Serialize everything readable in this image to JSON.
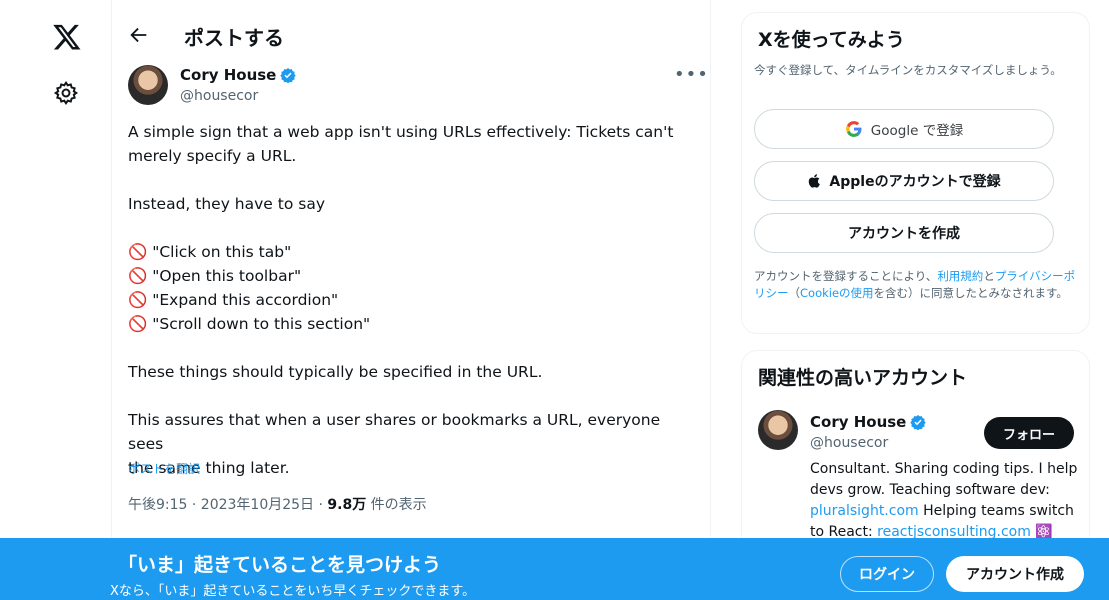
{
  "nav": {
    "logo_icon": "x-logo-icon",
    "settings_icon": "gear-icon"
  },
  "header": {
    "title": "ポストする",
    "back_icon": "arrow-left-icon"
  },
  "tweet": {
    "author_name": "Cory House",
    "author_handle": "@housecor",
    "more_icon": "more-horizontal-icon",
    "lines": [
      "A simple sign that a web app isn't using URLs effectively: Tickets can't",
      "merely specify a URL.",
      "",
      "Instead, they have to say",
      "",
      "🚫 \"Click on this tab\"",
      "🚫 \"Open this toolbar\"",
      "🚫 \"Expand this accordion\"",
      "🚫 \"Scroll down to this section\"",
      "",
      "These things should typically be specified in the URL.",
      "",
      "This assures that when a user shares or bookmarks a URL, everyone sees",
      "the same thing later."
    ],
    "translate": "ポストを翻訳",
    "time": "午後9:15 · 2023年10月25日 · ",
    "views_count": "9.8万",
    "views_label": " 件の表示"
  },
  "signup": {
    "title": "Xを使ってみよう",
    "subtitle": "今すぐ登録して、タイムラインをカスタマイズしましょう。",
    "google_label": "Google で登録",
    "apple_label": "Appleのアカウントで登録",
    "create_label": "アカウントを作成",
    "legal_prefix": "アカウントを登録することにより、",
    "legal_terms": "利用規約",
    "legal_and": "と",
    "legal_privacy": "プライバシーポリシー",
    "legal_paren_open": "（",
    "legal_cookie": "Cookieの使用",
    "legal_suffix": "を含む）に同意したとみなされます。"
  },
  "related": {
    "title": "関連性の高いアカウント",
    "name": "Cory House",
    "handle": "@housecor",
    "follow_label": "フォロー",
    "bio_text1": "Consultant. Sharing coding tips. I help devs grow. Teaching software dev: ",
    "bio_link1": "pluralsight.com",
    "bio_text2": " Helping teams switch to React: ",
    "bio_link2": "reactjsconsulting.com",
    "bio_emoji": " ⚛️"
  },
  "banner": {
    "title": "「いま」起きていることを見つけよう",
    "subtitle": "Xなら、「いま」起きていることをいち早くチェックできます。",
    "login_label": "ログイン",
    "create_label": "アカウント作成"
  },
  "colors": {
    "accent": "#1d9bf0",
    "text": "#0f1419",
    "muted": "#536471"
  }
}
